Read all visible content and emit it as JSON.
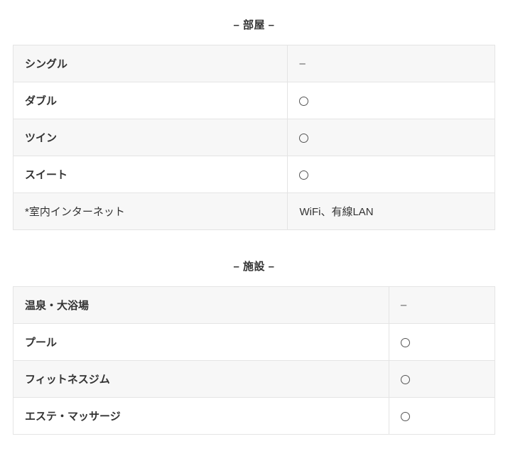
{
  "sections": {
    "rooms": {
      "title": "– 部屋 –",
      "rows": [
        {
          "label": "シングル",
          "value_type": "dash",
          "value": "–"
        },
        {
          "label": "ダブル",
          "value_type": "circle",
          "value": "○"
        },
        {
          "label": "ツイン",
          "value_type": "circle",
          "value": "○"
        },
        {
          "label": "スイート",
          "value_type": "circle",
          "value": "○"
        },
        {
          "label": "*室内インターネット",
          "value_type": "text",
          "value": "WiFi、有線LAN",
          "footnote": true
        }
      ]
    },
    "facilities": {
      "title": "– 施設 –",
      "rows": [
        {
          "label": "温泉・大浴場",
          "value_type": "dash",
          "value": "–"
        },
        {
          "label": "プール",
          "value_type": "circle",
          "value": "○"
        },
        {
          "label": "フィットネスジム",
          "value_type": "circle",
          "value": "○"
        },
        {
          "label": "エステ・マッサージ",
          "value_type": "circle",
          "value": "○"
        }
      ]
    }
  }
}
